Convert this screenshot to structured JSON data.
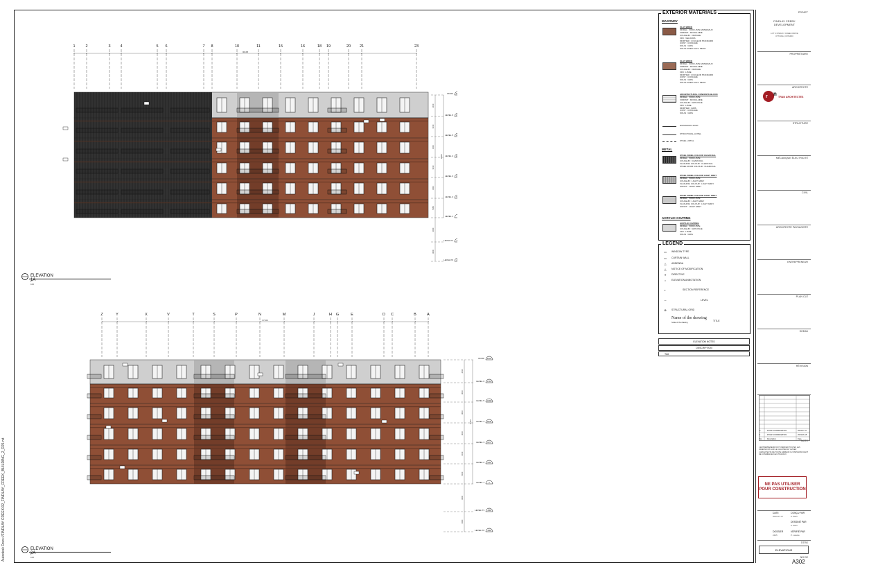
{
  "sheet": {
    "file_path": "Autodesk Docs://FINDLAY CREEK/02_FINDLAY_CREEK_BUILDING_2_R25.rvt",
    "sheet_number": "A302",
    "sheet_title": "ELEVATIONS"
  },
  "elevations": [
    {
      "title": "ELEVATION 1A",
      "scale": "1 : 100",
      "dim": "90195"
    },
    {
      "title": "ELEVATION 2A",
      "scale": "1 : 100",
      "dim": "67160"
    }
  ],
  "grid_top": [
    "1",
    "2",
    "3",
    "4",
    "5",
    "6",
    "7",
    "8",
    "10",
    "11",
    "15",
    "16",
    "18",
    "19",
    "20",
    "21",
    "23"
  ],
  "grid_bottom": [
    "Z",
    "Y",
    "X",
    "V",
    "T",
    "S",
    "P",
    "N",
    "M",
    "J",
    "H",
    "G",
    "E",
    "D",
    "C",
    "B",
    "A"
  ],
  "levels": [
    {
      "name": "ROOF",
      "elev": "20110"
    },
    {
      "name": "LEVEL 6",
      "elev": "17200"
    },
    {
      "name": "LEVEL 5",
      "elev": "14190"
    },
    {
      "name": "LEVEL 4",
      "elev": "11180"
    },
    {
      "name": "LEVEL 3",
      "elev": "8170"
    },
    {
      "name": "LEVEL 2",
      "elev": "5160"
    },
    {
      "name": "LEVEL 1",
      "elev": "0"
    },
    {
      "name": "LEVEL P1",
      "elev": "-3000"
    },
    {
      "name": "LEVEL P2",
      "elev": "-6000"
    }
  ],
  "level_dims": [
    "2910",
    "3010",
    "3010",
    "3010",
    "3010",
    "5160",
    "3000",
    "3000"
  ],
  "total_dim": "20110",
  "exterior_materials": {
    "title": "EXTERIOR MATERIALS",
    "masonry_title": "MASONRY",
    "metal_title": "METAL",
    "acrylic_title": "ACRYLIC COATING",
    "items": [
      {
        "tag": "B1",
        "color": "#8a5a46",
        "name": "CLAY BRICK",
        "lines": "MODEL : VOIR LISTE MATERIAUX\nFORMAT : MODULAIRE\nCOULEUR : ORANGE\nFINI : VELOURS\nMORTIER : COULEUR STANDARD\nJOINT : CONCAVE\nSOLIN : GRIS\nSOLIN ACIER GALV. PEINT"
      },
      {
        "tag": "B2",
        "color": "#9a6a55",
        "name": "CLAY BRICK",
        "lines": "MODEL : VOIR LISTE MATERIAUX\nFORMAT : MODULAIRE\nCOULEUR : ORANGE\nFINI : LISSE\nMORTIER : COULEUR STANDARD\nJOINT : CONCAVE\nSOLIN : GRIS\nSOLIN ACIER GALV. PEINT"
      },
      {
        "tag": "P1",
        "color": "#ededed",
        "name": "ARCHITECTURAL CONCRETE BLOCK",
        "lines": "MODEL : VOIR LISTE\nFORMAT : MODULAIRE\nCOULEUR : GRIS PALE\nFINI : LISSE\nMORTIER : GRIS\nJOINT : CONCAVE\nSOLIN : GRIS"
      }
    ],
    "lines_legend": [
      "EXPANSION JOINT",
      "STRUCTURAL LINTEL",
      "STEEL LINTEL"
    ],
    "metal_items": [
      {
        "tag": "M1",
        "color": "#3a3a3a",
        "name": "STEEL PANEL COLOUR CHARCOAL",
        "lines": "MODEL : VOIR LISTE\nCOULEUR : CHARCOAL\nFLASHING COLOUR : CHARCOAL\nSTEEL DOOR COLOUR : CHARCOAL"
      },
      {
        "tag": "M2",
        "color": "#9b9b9b",
        "name": "STEEL PANEL COLOUR LIGHT GREY",
        "lines": "MODEL : VOIR LISTE\nCOULEUR : LIGHT GREY\nFLASHING COLOUR : LIGHT GREY\nSOFFIT : LIGHT GREY"
      },
      {
        "tag": "M3",
        "color": "#c9c9c9",
        "name": "STEEL PANEL COLOUR LIGHT GREY",
        "lines": "MODEL : VOIR LISTE\nCOULEUR : LIGHT GREY\nFLASHING COLOUR : LIGHT GREY\nSOFFIT : LIGHT GREY"
      }
    ],
    "acrylic_item": {
      "tag": "AC",
      "color": "#d8d8d8",
      "name": "ACRYLIC COATING",
      "lines": "MODEL : VOIR LISTE\nCOULEUR : GRIS PALE\nFINI : LISSE\nSOLIN : GRIS"
    }
  },
  "legend": {
    "title": "LEGEND",
    "rows": [
      "WINDOW TYPE",
      "CURTAIN WALL",
      "ADDENDA",
      "NOTICE OF MODIFICATION",
      "DIRECTIVE",
      "ELEVATION ANNOTATION",
      "SECTION REFERENCE",
      "LEVEL",
      "STRUCTURAL GRID"
    ],
    "drawing_name": "Name of the drawing",
    "drawing_scale_hint": "Scale of the drawing",
    "title_word": "TITLE"
  },
  "elevation_notes": {
    "header": "ELEVATION NOTES",
    "sub": "DESCRIPTION",
    "first": "Text"
  },
  "title_block": {
    "projet_label": "PROJET",
    "project_name": "FINDLAY CREEK\nDEVELOPMENT",
    "project_addr": "LOT 4 FINDLAY CREEK DRIVE\nOTTAWA, ONTARIO",
    "labels": [
      "PROPRIÉTAIRE",
      "ARCHITECTE",
      "STRUCTURE",
      "MÉCANIQUE ÉLECTRICITÉ",
      "CIVIL",
      "ARCHITECTE PAYSAGISTE",
      "ENTREPRENEUR",
      "PLAN CLÉ",
      "SCEAU",
      "RÉVISION",
      "NOTE"
    ],
    "firm": "TRAN ARCHITECTES",
    "stamp_text": "NE PAS UTILISER POUR CONSTRUCTION",
    "date_label": "DATE",
    "date_value": "2023-07-17",
    "concu_label": "CONÇU PAR",
    "concu_value": "A. Baril",
    "dessine_label": "DESSINÉ PAR",
    "dessine_value": "A. Baril",
    "dossier_label": "DOSSIER",
    "dossier_value": "2445",
    "verifie_label": "VÉRIFIÉ PAR",
    "verifie_value": "P. Lacelle",
    "titre_label": "TITRE",
    "no_label": "NO DE",
    "revision_rows": [
      {
        "no": "2",
        "desc": "POUR COORDINATION",
        "date": "2023-07-17"
      },
      {
        "no": "1",
        "desc": "POUR COORDINATION",
        "date": "2023-06-15"
      },
      {
        "no": "No",
        "desc": "Description",
        "date": "Date"
      }
    ],
    "note_text": "L'ENTREPRENEUR DOIT VÉRIFIER TOUTES LES DIMENSIONS SUR LE CHANTIER ET AVISER L'ARCHITECTE DE TOUTE ERREUR OU OMISSION AVANT DE COMMENCER LES TRAVAUX."
  },
  "colors": {
    "brick": "#8f4f36",
    "brick_dark": "#6e3a27",
    "charcoal": "#2b2b2b",
    "light_grey": "#cfcfcf",
    "mid_grey": "#a9a9a9",
    "stamp_red": "#a31d24"
  }
}
